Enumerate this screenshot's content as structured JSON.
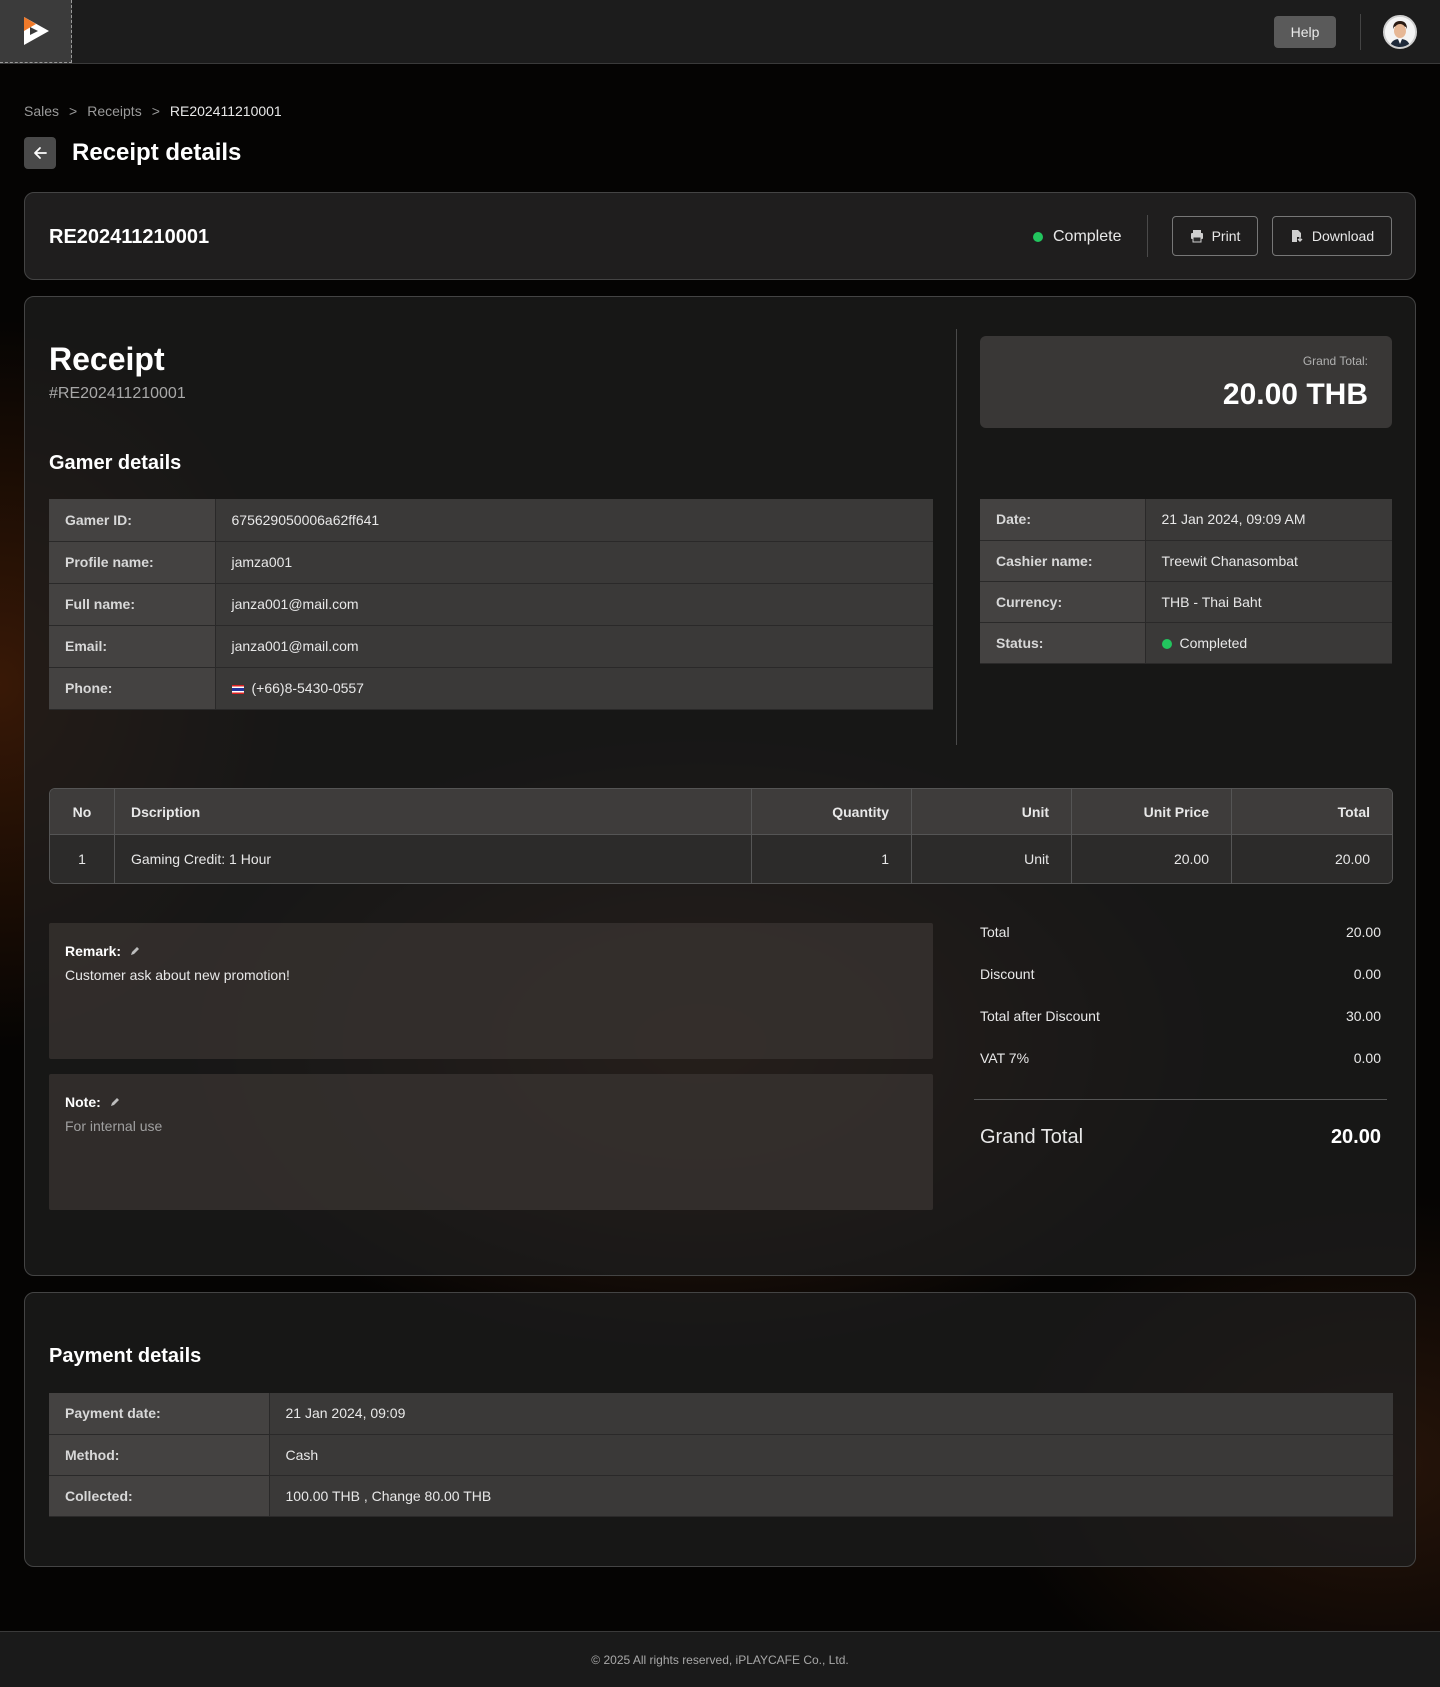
{
  "topbar": {
    "help_label": "Help"
  },
  "breadcrumb": {
    "items": [
      "Sales",
      "Receipts"
    ],
    "separator": ">",
    "current": "RE202411210001"
  },
  "page": {
    "title": "Receipt details"
  },
  "header_card": {
    "receipt_id": "RE202411210001",
    "status_label": "Complete",
    "status_color": "#22c55e",
    "print_label": "Print",
    "download_label": "Download"
  },
  "receipt": {
    "title": "Receipt",
    "number": "#RE202411210001",
    "grand_total_label": "Grand Total:",
    "grand_total_value": "20.00 THB"
  },
  "gamer_details": {
    "title": "Gamer details",
    "rows": [
      {
        "label": "Gamer ID:",
        "value": "675629050006a62ff641"
      },
      {
        "label": "Profile name:",
        "value": "jamza001"
      },
      {
        "label": "Full name:",
        "value": "janza001@mail.com"
      },
      {
        "label": "Email:",
        "value": "janza001@mail.com"
      },
      {
        "label": "Phone:",
        "value": "(+66)8-5430-0557",
        "icon": "thailand-flag-icon"
      }
    ]
  },
  "receipt_info": {
    "rows": [
      {
        "label": "Date:",
        "value": "21 Jan 2024, 09:09 AM"
      },
      {
        "label": "Cashier name:",
        "value": "Treewit Chanasombat"
      },
      {
        "label": "Currency:",
        "value": "THB - Thai Baht"
      },
      {
        "label": "Status:",
        "value": "Completed",
        "icon": "status-dot-icon"
      }
    ]
  },
  "items_table": {
    "columns": [
      "No",
      "Dscription",
      "Quantity",
      "Unit",
      "Unit Price",
      "Total"
    ],
    "rows": [
      {
        "no": "1",
        "description": "Gaming Credit: 1 Hour",
        "quantity": "1",
        "unit": "Unit",
        "unit_price": "20.00",
        "total": "20.00"
      }
    ]
  },
  "remark": {
    "label": "Remark:",
    "text": "Customer ask about new promotion!"
  },
  "note": {
    "label": "Note:",
    "placeholder": "For internal use"
  },
  "summary": {
    "rows": [
      {
        "label": "Total",
        "value": "20.00"
      },
      {
        "label": "Discount",
        "value": "0.00"
      },
      {
        "label": "Total after Discount",
        "value": "30.00"
      },
      {
        "label": "VAT 7%",
        "value": "0.00"
      }
    ],
    "grand_total_label": "Grand Total",
    "grand_total_value": "20.00"
  },
  "payment_details": {
    "title": "Payment details",
    "rows": [
      {
        "label": "Payment date:",
        "value": "21 Jan 2024, 09:09"
      },
      {
        "label": "Method:",
        "value": "Cash"
      },
      {
        "label": "Collected:",
        "value": "100.00 THB , Change 80.00 THB"
      }
    ]
  },
  "footer": {
    "copyright": "© 2025 All rights reserved, iPLAYCAFE Co., Ltd."
  }
}
